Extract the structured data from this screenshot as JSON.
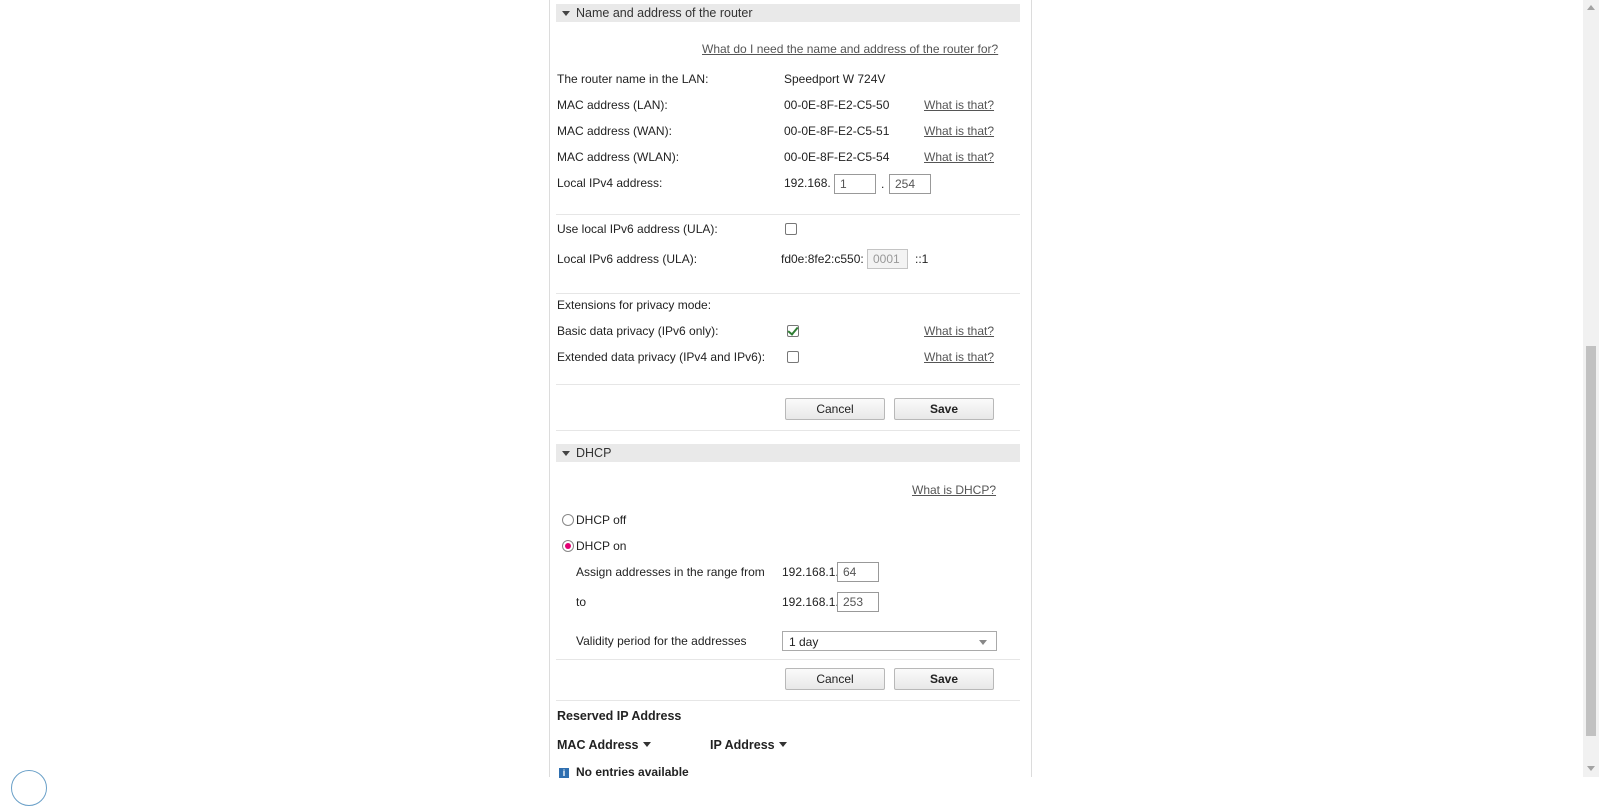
{
  "router_section": {
    "title": "Name and address of the router",
    "help_link": "What do I need the name and address of the router for?",
    "router_name_label": "The router name in the LAN:",
    "router_name_value": "Speedport W 724V",
    "mac_lan_label": "MAC address (LAN):",
    "mac_lan_value": "00-0E-8F-E2-C5-50",
    "mac_wan_label": "MAC address (WAN):",
    "mac_wan_value": "00-0E-8F-E2-C5-51",
    "mac_wlan_label": "MAC address (WLAN):",
    "mac_wlan_value": "00-0E-8F-E2-C5-54",
    "what_is_that": "What is that?",
    "ipv4_label": "Local IPv4 address:",
    "ipv4_prefix": "192.168.",
    "ipv4_octet3": "1",
    "ipv4_dot": ".",
    "ipv4_octet4": "254",
    "use_ula_label": "Use local IPv6 address (ULA):",
    "use_ula_checked": false,
    "ula_label": "Local IPv6 address (ULA):",
    "ula_prefix": "fd0e:8fe2:c550:",
    "ula_subnet": "0001",
    "ula_suffix": "::1",
    "privacy_heading": "Extensions for privacy mode:",
    "basic_privacy_label": "Basic data privacy (IPv6 only):",
    "basic_privacy_checked": true,
    "extended_privacy_label": "Extended data privacy (IPv4 and IPv6):",
    "extended_privacy_checked": false,
    "cancel_label": "Cancel",
    "save_label": "Save"
  },
  "dhcp_section": {
    "title": "DHCP",
    "help_link": "What is DHCP?",
    "dhcp_off_label": "DHCP off",
    "dhcp_on_label": "DHCP on",
    "selected": "on",
    "range_from_label": "Assign addresses in the range from",
    "range_prefix": "192.168.1.",
    "range_from_value": "64",
    "range_to_label": "to",
    "range_to_value": "253",
    "validity_label": "Validity period for the addresses",
    "validity_value": "1 day",
    "cancel_label": "Cancel",
    "save_label": "Save"
  },
  "reserved_section": {
    "title": "Reserved IP Address",
    "columns": [
      "MAC Address",
      "IP Address"
    ],
    "empty_text": "No entries available"
  },
  "colors": {
    "accent_magenta": "#e20074",
    "check_green": "#2e7d32",
    "section_header_bg": "#e9e9e9"
  }
}
